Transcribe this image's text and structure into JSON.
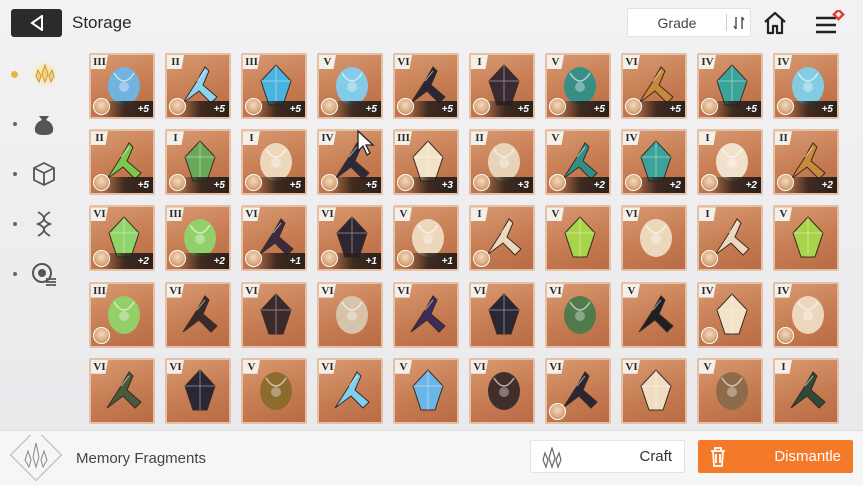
{
  "header": {
    "title": "Storage",
    "grade_label": "Grade"
  },
  "sidebar": {
    "items": [
      {
        "name": "sidebar-item-memory-fragments",
        "icon": "crystal-icon",
        "active": true
      },
      {
        "name": "sidebar-item-materials",
        "icon": "bag-icon",
        "active": false
      },
      {
        "name": "sidebar-item-cubes",
        "icon": "cube-icon",
        "active": false
      },
      {
        "name": "sidebar-item-genes",
        "icon": "dna-icon",
        "active": false
      },
      {
        "name": "sidebar-item-misc",
        "icon": "coin-icon",
        "active": false
      }
    ]
  },
  "items": [
    {
      "rank": "III",
      "plus": "+5",
      "avatar": true,
      "color": "#6bb6e6"
    },
    {
      "rank": "II",
      "plus": "+5",
      "avatar": true,
      "color": "#8fd4ef"
    },
    {
      "rank": "III",
      "plus": "+5",
      "avatar": true,
      "color": "#49b4e0"
    },
    {
      "rank": "V",
      "plus": "+5",
      "avatar": true,
      "color": "#7fd0f0"
    },
    {
      "rank": "VI",
      "plus": "+5",
      "avatar": true,
      "color": "#2a2633"
    },
    {
      "rank": "I",
      "plus": "+5",
      "avatar": true,
      "color": "#3a2a35"
    },
    {
      "rank": "V",
      "plus": "+5",
      "avatar": true,
      "color": "#2f8f8a"
    },
    {
      "rank": "VI",
      "plus": "+5",
      "avatar": true,
      "color": "#c78a3a"
    },
    {
      "rank": "IV",
      "plus": "+5",
      "avatar": true,
      "color": "#3aa39a"
    },
    {
      "rank": "IV",
      "plus": "+5",
      "avatar": true,
      "color": "#7fd0ea"
    },
    {
      "rank": "II",
      "plus": "+5",
      "avatar": true,
      "color": "#7ac94a"
    },
    {
      "rank": "I",
      "plus": "+5",
      "avatar": true,
      "color": "#6aa85a"
    },
    {
      "rank": "I",
      "plus": "+5",
      "avatar": true,
      "color": "#efdcc2"
    },
    {
      "rank": "IV",
      "plus": "+5",
      "avatar": true,
      "color": "#2a2a3a"
    },
    {
      "rank": "III",
      "plus": "+3",
      "avatar": true,
      "color": "#f1e2c8"
    },
    {
      "rank": "II",
      "plus": "+3",
      "avatar": true,
      "color": "#ead8bf"
    },
    {
      "rank": "V",
      "plus": "+2",
      "avatar": true,
      "color": "#2f8f8a"
    },
    {
      "rank": "IV",
      "plus": "+2",
      "avatar": true,
      "color": "#3aa39a"
    },
    {
      "rank": "I",
      "plus": "+2",
      "avatar": true,
      "color": "#f3e6d2"
    },
    {
      "rank": "II",
      "plus": "+2",
      "avatar": true,
      "color": "#c78a3a"
    },
    {
      "rank": "VI",
      "plus": "+2",
      "avatar": true,
      "color": "#8fd46a"
    },
    {
      "rank": "III",
      "plus": "+2",
      "avatar": true,
      "color": "#8fd46a"
    },
    {
      "rank": "VI",
      "plus": "+1",
      "avatar": true,
      "color": "#3a2c3d"
    },
    {
      "rank": "VI",
      "plus": "+1",
      "avatar": true,
      "color": "#2d2530"
    },
    {
      "rank": "V",
      "plus": "+1",
      "avatar": true,
      "color": "#efdcc2"
    },
    {
      "rank": "I",
      "plus": "",
      "avatar": true,
      "color": "#ead8bf"
    },
    {
      "rank": "V",
      "plus": "",
      "avatar": false,
      "color": "#a8d44a"
    },
    {
      "rank": "VI",
      "plus": "",
      "avatar": false,
      "color": "#efdcc2"
    },
    {
      "rank": "I",
      "plus": "",
      "avatar": true,
      "color": "#ead8bf"
    },
    {
      "rank": "V",
      "plus": "",
      "avatar": false,
      "color": "#a8d44a"
    },
    {
      "rank": "III",
      "plus": "",
      "avatar": true,
      "color": "#8fd46a"
    },
    {
      "rank": "VI",
      "plus": "",
      "avatar": false,
      "color": "#3a2a2a"
    },
    {
      "rank": "VI",
      "plus": "",
      "avatar": false,
      "color": "#3a2a2a"
    },
    {
      "rank": "VI",
      "plus": "",
      "avatar": false,
      "color": "#d8c6b0"
    },
    {
      "rank": "VI",
      "plus": "",
      "avatar": false,
      "color": "#3c2c5a"
    },
    {
      "rank": "VI",
      "plus": "",
      "avatar": false,
      "color": "#2a2633"
    },
    {
      "rank": "VI",
      "plus": "",
      "avatar": false,
      "color": "#4a7a4a"
    },
    {
      "rank": "V",
      "plus": "",
      "avatar": false,
      "color": "#1e1e24"
    },
    {
      "rank": "IV",
      "plus": "",
      "avatar": true,
      "color": "#f1e2c8"
    },
    {
      "rank": "IV",
      "plus": "",
      "avatar": true,
      "color": "#efdcc2"
    },
    {
      "rank": "VI",
      "plus": "",
      "avatar": false,
      "color": "#4a5a3a"
    },
    {
      "rank": "VI",
      "plus": "",
      "avatar": false,
      "color": "#2a2633"
    },
    {
      "rank": "V",
      "plus": "",
      "avatar": false,
      "color": "#8a6a2a"
    },
    {
      "rank": "VI",
      "plus": "",
      "avatar": false,
      "color": "#7fd0f0"
    },
    {
      "rank": "V",
      "plus": "",
      "avatar": false,
      "color": "#6bb6e6"
    },
    {
      "rank": "VI",
      "plus": "",
      "avatar": false,
      "color": "#3a2a2a"
    },
    {
      "rank": "VI",
      "plus": "",
      "avatar": true,
      "color": "#2a2633"
    },
    {
      "rank": "VI",
      "plus": "",
      "avatar": false,
      "color": "#efdcc2"
    },
    {
      "rank": "V",
      "plus": "",
      "avatar": false,
      "color": "#8a6a4a"
    },
    {
      "rank": "I",
      "plus": "",
      "avatar": false,
      "color": "#2f4a3a"
    }
  ],
  "footer": {
    "fragments_label": "Memory Fragments",
    "craft_label": "Craft",
    "dismantle_label": "Dismantle"
  },
  "colors": {
    "accent_orange": "#f47a2a",
    "cell_bg": "#c67c52",
    "active_gold": "#e3b73f",
    "notify_red": "#e53935"
  }
}
